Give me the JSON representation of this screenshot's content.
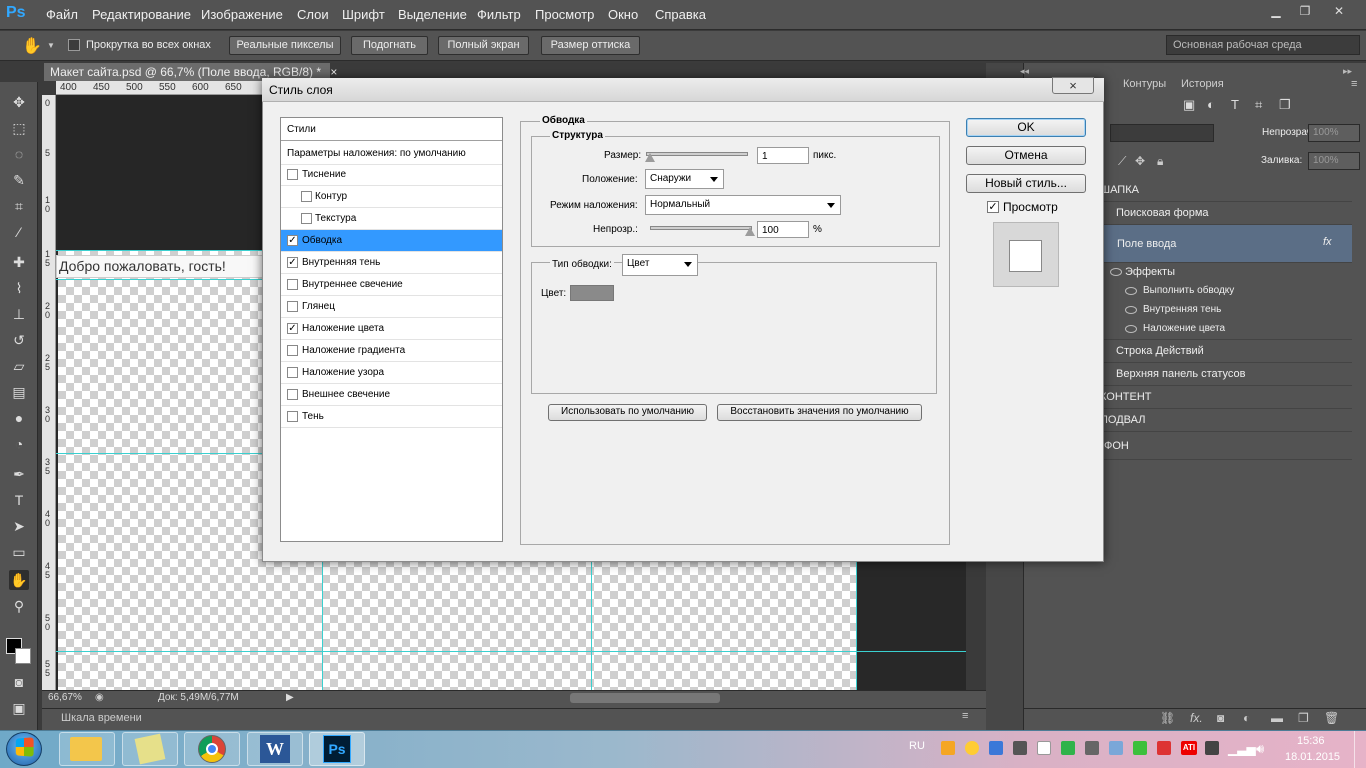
{
  "app": {
    "logo": "Ps",
    "menu": [
      "Файл",
      "Редактирование",
      "Изображение",
      "Слои",
      "Шрифт",
      "Выделение",
      "Фильтр",
      "Просмотр",
      "Окно",
      "Справка"
    ]
  },
  "options": {
    "scroll_all_windows": "Прокрутка во всех окнах",
    "buttons": [
      "Реальные пикселы",
      "Подогнать",
      "Полный экран",
      "Размер оттиска"
    ],
    "workspace": "Основная рабочая среда"
  },
  "document": {
    "tab_title": "Макет сайта.psd @ 66,7% (Поле ввода, RGB/8) *",
    "ruler_h": [
      "400",
      "450",
      "500",
      "550",
      "600",
      "650"
    ],
    "ruler_v": [
      "0",
      "5",
      "1 0",
      "1 5",
      "2 0",
      "2 5",
      "3 0",
      "3 5",
      "4 0",
      "4 5",
      "5 0",
      "5 5"
    ],
    "input_text": "Добро пожаловать, гость!",
    "zoom": "66,67%",
    "doc_info": "Док: 5,49M/6,77M",
    "timeline": "Шкала времени"
  },
  "layers_panel": {
    "tabs": [
      "Контуры",
      "История"
    ],
    "opacity_label": "Непрозрачность:",
    "opacity_value": "100%",
    "fill_label": "Заливка:",
    "fill_value": "100%",
    "layers": [
      {
        "name": "ШАПКА",
        "indent": 0
      },
      {
        "name": "Поисковая форма",
        "indent": 1
      },
      {
        "name": "Поле ввода",
        "indent": 1
      },
      {
        "name": "Эффекты",
        "indent": 2
      },
      {
        "name": "Выполнить обводку",
        "indent": 3
      },
      {
        "name": "Внутренняя тень",
        "indent": 3
      },
      {
        "name": "Наложение цвета",
        "indent": 3
      },
      {
        "name": "Строка Действий",
        "indent": 1
      },
      {
        "name": "Верхняя панель статусов",
        "indent": 1
      },
      {
        "name": "КОНТЕНТ",
        "indent": 0
      },
      {
        "name": "ПОДВАЛ",
        "indent": 0
      },
      {
        "name": "ФОН",
        "indent": 0
      }
    ]
  },
  "dialog": {
    "title": "Стиль слоя",
    "close": "×",
    "styles_header": "Стили",
    "blending_options": "Параметры наложения: по умолчанию",
    "styles": [
      {
        "label": "Тиснение",
        "checked": false,
        "sub": false
      },
      {
        "label": "Контур",
        "checked": false,
        "sub": true
      },
      {
        "label": "Текстура",
        "checked": false,
        "sub": true
      },
      {
        "label": "Обводка",
        "checked": true,
        "sub": false,
        "selected": true
      },
      {
        "label": "Внутренняя тень",
        "checked": true,
        "sub": false
      },
      {
        "label": "Внутреннее свечение",
        "checked": false,
        "sub": false
      },
      {
        "label": "Глянец",
        "checked": false,
        "sub": false
      },
      {
        "label": "Наложение цвета",
        "checked": true,
        "sub": false
      },
      {
        "label": "Наложение градиента",
        "checked": false,
        "sub": false
      },
      {
        "label": "Наложение узора",
        "checked": false,
        "sub": false
      },
      {
        "label": "Внешнее свечение",
        "checked": false,
        "sub": false
      },
      {
        "label": "Тень",
        "checked": false,
        "sub": false
      }
    ],
    "stroke": {
      "section": "Обводка",
      "structure": "Структура",
      "size_label": "Размер:",
      "size_value": "1",
      "size_unit": "пикс.",
      "position_label": "Положение:",
      "position_value": "Снаружи",
      "blend_label": "Режим наложения:",
      "blend_value": "Нормальный",
      "opacity_label": "Непрозр.:",
      "opacity_value": "100",
      "opacity_unit": "%",
      "fill_type_label": "Тип обводки:",
      "fill_type_value": "Цвет",
      "color_label": "Цвет:",
      "color": "#8a8a8a",
      "size_fraction": 0.01,
      "opacity_fraction": 1.0
    },
    "btn_default": "Использовать по умолчанию",
    "btn_reset": "Восстановить значения по умолчанию",
    "ok": "OK",
    "cancel": "Отмена",
    "new_style": "Новый стиль...",
    "preview": "Просмотр"
  },
  "taskbar": {
    "lang": "RU",
    "time": "15:36",
    "date": "18.01.2015"
  },
  "colors": {
    "accent": "#3399ff",
    "guide": "#3ad0d0"
  }
}
